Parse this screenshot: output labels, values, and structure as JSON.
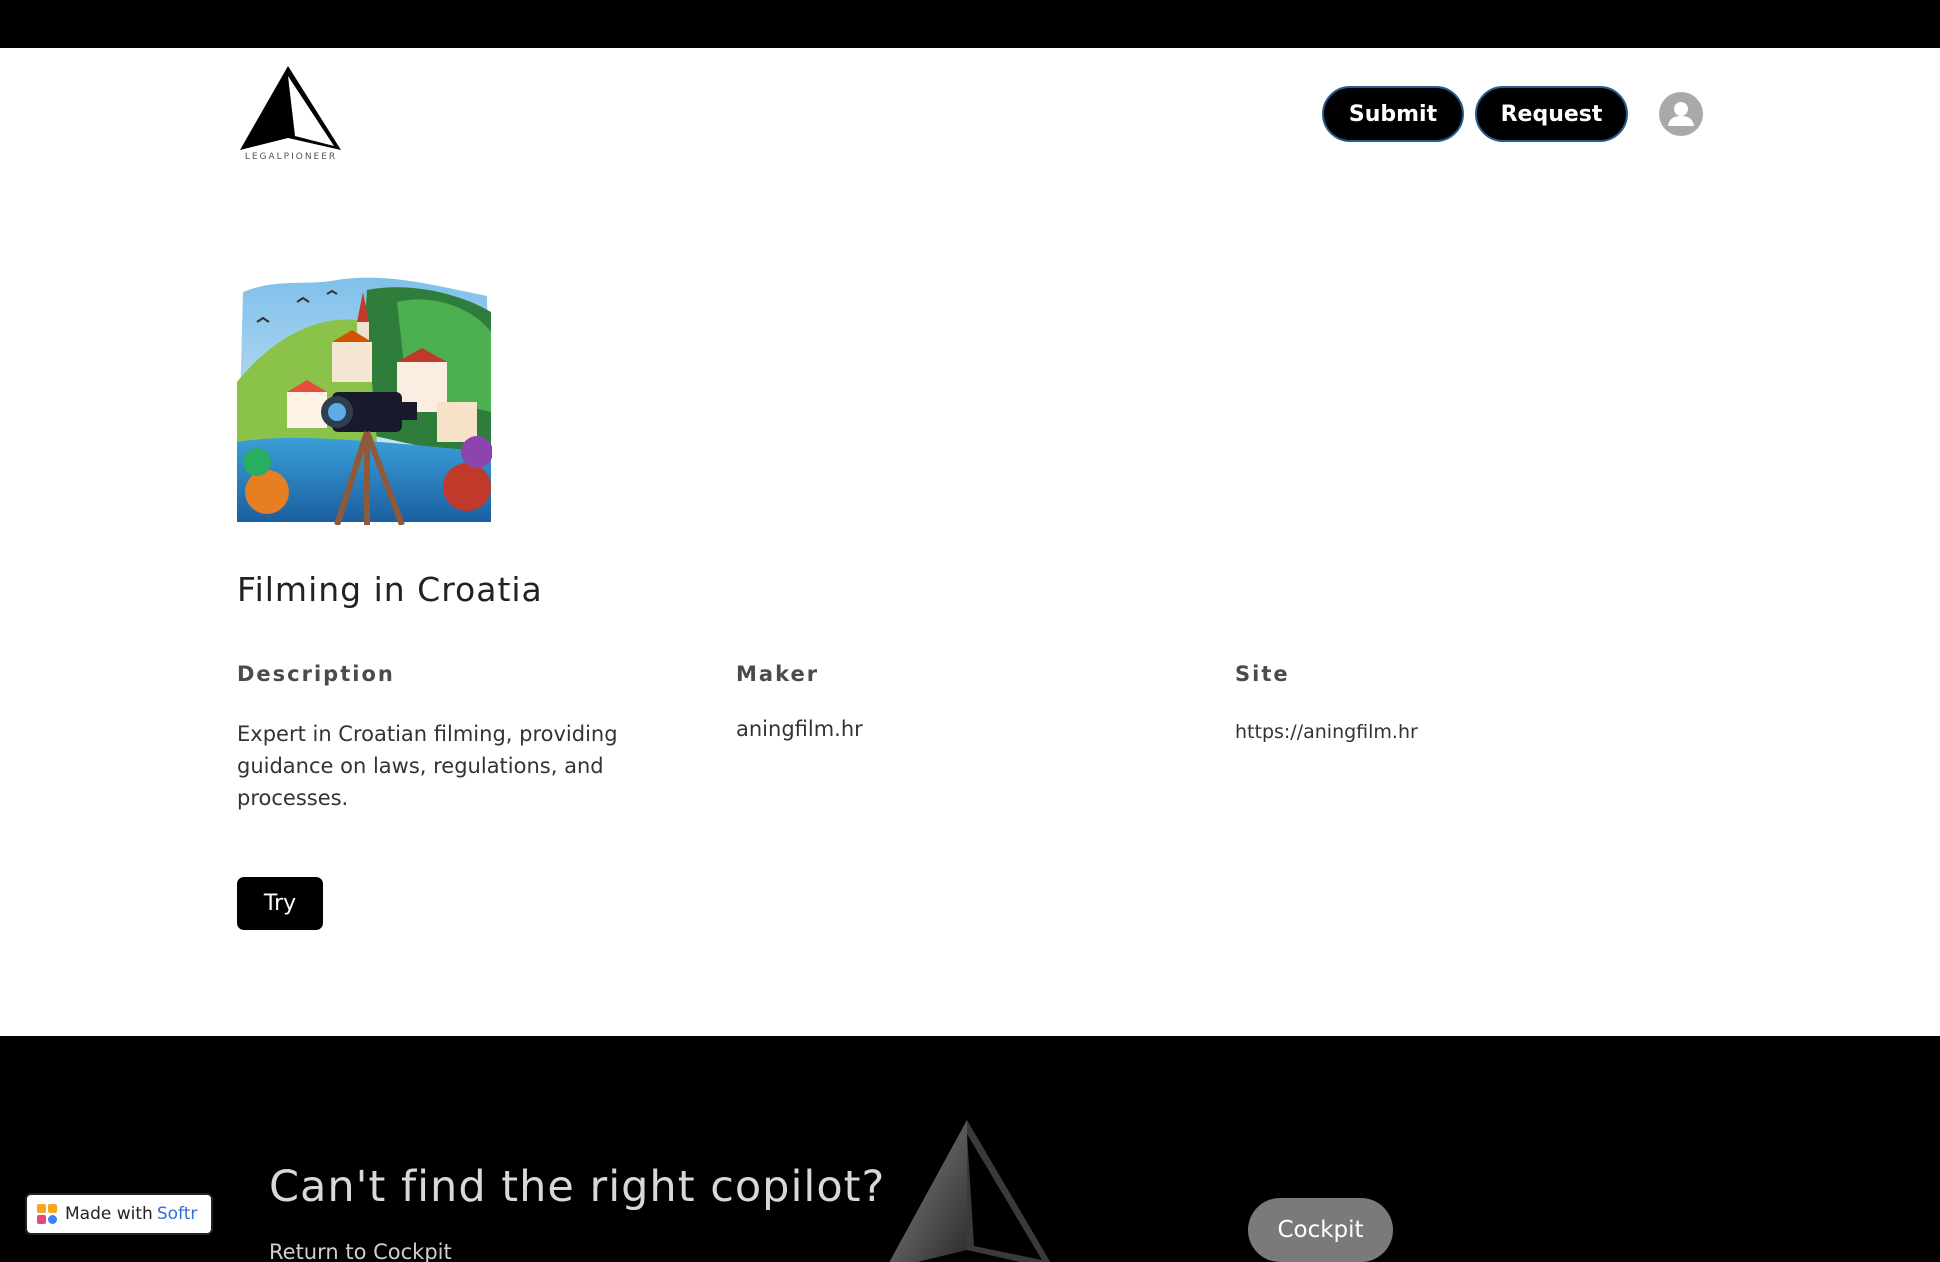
{
  "header": {
    "logo_text": "LEGALPIONEER",
    "submit_label": "Submit",
    "request_label": "Request"
  },
  "copilot": {
    "title": "Filming in Croatia",
    "columns": {
      "description_label": "Description",
      "maker_label": "Maker",
      "site_label": "Site"
    },
    "description": "Expert in Croatian filming, providing guidance on laws, regulations, and processes.",
    "maker": "aningfilm.hr",
    "site": "https://aningfilm.hr",
    "try_label": "Try"
  },
  "footer": {
    "heading": "Can't find the right copilot?",
    "link": "Return to Cockpit",
    "cockpit_label": "Cockpit"
  },
  "badge": {
    "made_with": "Made with",
    "brand": "Softr"
  },
  "colors": {
    "accent_black": "#000000",
    "button_border": "#2a5c8f",
    "softr_blue": "#2f6fd6"
  },
  "icons": [
    "logo-icon",
    "user-avatar-icon",
    "softr-logo-icon"
  ]
}
